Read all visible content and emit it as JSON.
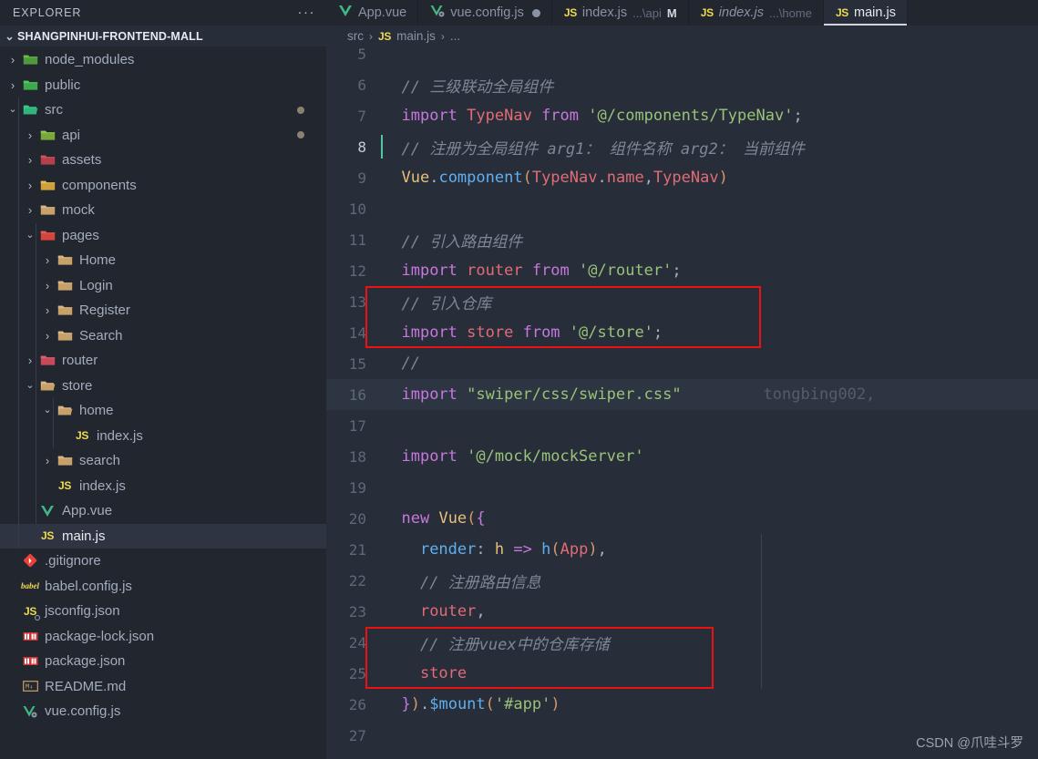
{
  "sidebar": {
    "header_title": "EXPLORER",
    "more_actions": "···",
    "root_label": "SHANGPINHUI-FRONTEND-MALL",
    "items": [
      {
        "label": "node_modules",
        "icon": "nodejs-folder-icon",
        "depth": 0,
        "state": "collapsed",
        "kind": "folder",
        "dirty": false
      },
      {
        "label": "public",
        "icon": "public-folder-icon",
        "depth": 0,
        "state": "collapsed",
        "kind": "folder",
        "dirty": false
      },
      {
        "label": "src",
        "icon": "src-folder-icon",
        "depth": 0,
        "state": "expanded",
        "kind": "folder",
        "dirty": true
      },
      {
        "label": "api",
        "icon": "api-folder-icon",
        "depth": 1,
        "state": "collapsed",
        "kind": "folder",
        "dirty": true
      },
      {
        "label": "assets",
        "icon": "assets-folder-icon",
        "depth": 1,
        "state": "collapsed",
        "kind": "folder",
        "dirty": false
      },
      {
        "label": "components",
        "icon": "components-folder-icon",
        "depth": 1,
        "state": "collapsed",
        "kind": "folder",
        "dirty": false
      },
      {
        "label": "mock",
        "icon": "folder-icon",
        "depth": 1,
        "state": "collapsed",
        "kind": "folder",
        "dirty": false
      },
      {
        "label": "pages",
        "icon": "pages-folder-icon",
        "depth": 1,
        "state": "expanded",
        "kind": "folder",
        "dirty": false
      },
      {
        "label": "Home",
        "icon": "folder-icon",
        "depth": 2,
        "state": "collapsed",
        "kind": "folder",
        "dirty": false
      },
      {
        "label": "Login",
        "icon": "folder-icon",
        "depth": 2,
        "state": "collapsed",
        "kind": "folder",
        "dirty": false
      },
      {
        "label": "Register",
        "icon": "folder-icon",
        "depth": 2,
        "state": "collapsed",
        "kind": "folder",
        "dirty": false
      },
      {
        "label": "Search",
        "icon": "folder-icon",
        "depth": 2,
        "state": "collapsed",
        "kind": "folder",
        "dirty": false
      },
      {
        "label": "router",
        "icon": "router-folder-icon",
        "depth": 1,
        "state": "collapsed",
        "kind": "folder",
        "dirty": false
      },
      {
        "label": "store",
        "icon": "folder-open-icon",
        "depth": 1,
        "state": "expanded",
        "kind": "folder",
        "dirty": false
      },
      {
        "label": "home",
        "icon": "folder-open-icon",
        "depth": 2,
        "state": "expanded",
        "kind": "folder",
        "dirty": false
      },
      {
        "label": "index.js",
        "icon": "js-file-icon",
        "depth": 3,
        "state": "none",
        "kind": "file",
        "dirty": false
      },
      {
        "label": "search",
        "icon": "folder-icon",
        "depth": 2,
        "state": "collapsed",
        "kind": "folder",
        "dirty": false
      },
      {
        "label": "index.js",
        "icon": "js-file-icon",
        "depth": 2,
        "state": "none",
        "kind": "file",
        "dirty": false
      },
      {
        "label": "App.vue",
        "icon": "vue-file-icon",
        "depth": 1,
        "state": "none",
        "kind": "file",
        "dirty": false
      },
      {
        "label": "main.js",
        "icon": "js-file-icon",
        "depth": 1,
        "state": "none",
        "kind": "file",
        "dirty": false,
        "selected": true
      },
      {
        "label": ".gitignore",
        "icon": "git-file-icon",
        "depth": 0,
        "state": "none",
        "kind": "file",
        "dirty": false
      },
      {
        "label": "babel.config.js",
        "icon": "babel-file-icon",
        "depth": 0,
        "state": "none",
        "kind": "file",
        "dirty": false
      },
      {
        "label": "jsconfig.json",
        "icon": "jsconfig-file-icon",
        "depth": 0,
        "state": "none",
        "kind": "file",
        "dirty": false
      },
      {
        "label": "package-lock.json",
        "icon": "npm-file-icon",
        "depth": 0,
        "state": "none",
        "kind": "file",
        "dirty": false
      },
      {
        "label": "package.json",
        "icon": "npm-file-icon",
        "depth": 0,
        "state": "none",
        "kind": "file",
        "dirty": false
      },
      {
        "label": "README.md",
        "icon": "markdown-file-icon",
        "depth": 0,
        "state": "none",
        "kind": "file",
        "dirty": false
      },
      {
        "label": "vue.config.js",
        "icon": "vue-config-file-icon",
        "depth": 0,
        "state": "none",
        "kind": "file",
        "dirty": false
      }
    ]
  },
  "tabs": [
    {
      "name": "App.vue",
      "path": "",
      "badge": "",
      "icon": "vue-file-icon",
      "active": false,
      "preview": false,
      "dirty": false
    },
    {
      "name": "vue.config.js",
      "path": "",
      "badge": "",
      "icon": "vue-config-file-icon",
      "active": false,
      "preview": false,
      "dirty": true
    },
    {
      "name": "index.js",
      "path": "...\\api",
      "badge": "M",
      "icon": "js-file-icon",
      "active": false,
      "preview": false,
      "dirty": false
    },
    {
      "name": "index.js",
      "path": "...\\home",
      "badge": "",
      "icon": "js-file-icon",
      "active": false,
      "preview": true,
      "dirty": false
    },
    {
      "name": "main.js",
      "path": "",
      "badge": "",
      "icon": "js-file-icon",
      "active": true,
      "preview": false,
      "dirty": false
    }
  ],
  "breadcrumb": {
    "folder": "src",
    "file": "main.js",
    "ellipsis": "...",
    "separator": "›"
  },
  "editor": {
    "blame_annotation": "tongbing002,",
    "highlighted_line": 16,
    "cursor_line": 8,
    "lines": [
      {
        "n": 5,
        "tokens": []
      },
      {
        "n": 6,
        "tokens": [
          {
            "t": "  ",
            "c": "pun"
          },
          {
            "t": "// 三级联动全局组件",
            "c": "cmt"
          }
        ]
      },
      {
        "n": 7,
        "tokens": [
          {
            "t": "  ",
            "c": "pun"
          },
          {
            "t": "import",
            "c": "kw"
          },
          {
            "t": " ",
            "c": "pun"
          },
          {
            "t": "TypeNav",
            "c": "var"
          },
          {
            "t": " ",
            "c": "pun"
          },
          {
            "t": "from",
            "c": "kw"
          },
          {
            "t": " ",
            "c": "pun"
          },
          {
            "t": "'@/components/TypeNav'",
            "c": "str"
          },
          {
            "t": ";",
            "c": "pun"
          }
        ]
      },
      {
        "n": 8,
        "tokens": [
          {
            "t": "  ",
            "c": "pun"
          },
          {
            "t": "// 注册为全局组件 arg1： 组件名称 arg2： 当前组件",
            "c": "cmt"
          }
        ]
      },
      {
        "n": 9,
        "tokens": [
          {
            "t": "  ",
            "c": "pun"
          },
          {
            "t": "Vue",
            "c": "cls"
          },
          {
            "t": ".",
            "c": "pun"
          },
          {
            "t": "component",
            "c": "fn"
          },
          {
            "t": "(",
            "c": "par"
          },
          {
            "t": "TypeNav",
            "c": "var"
          },
          {
            "t": ".",
            "c": "pun"
          },
          {
            "t": "name",
            "c": "var"
          },
          {
            "t": ",",
            "c": "pun"
          },
          {
            "t": "TypeNav",
            "c": "var"
          },
          {
            "t": ")",
            "c": "par"
          }
        ]
      },
      {
        "n": 10,
        "tokens": []
      },
      {
        "n": 11,
        "tokens": [
          {
            "t": "  ",
            "c": "pun"
          },
          {
            "t": "// 引入路由组件",
            "c": "cmt"
          }
        ]
      },
      {
        "n": 12,
        "tokens": [
          {
            "t": "  ",
            "c": "pun"
          },
          {
            "t": "import",
            "c": "kw"
          },
          {
            "t": " ",
            "c": "pun"
          },
          {
            "t": "router",
            "c": "var"
          },
          {
            "t": " ",
            "c": "pun"
          },
          {
            "t": "from",
            "c": "kw"
          },
          {
            "t": " ",
            "c": "pun"
          },
          {
            "t": "'@/router'",
            "c": "str"
          },
          {
            "t": ";",
            "c": "pun"
          }
        ]
      },
      {
        "n": 13,
        "tokens": [
          {
            "t": "  ",
            "c": "pun"
          },
          {
            "t": "// 引入仓库",
            "c": "cmt"
          }
        ]
      },
      {
        "n": 14,
        "tokens": [
          {
            "t": "  ",
            "c": "pun"
          },
          {
            "t": "import",
            "c": "kw"
          },
          {
            "t": " ",
            "c": "pun"
          },
          {
            "t": "store",
            "c": "var"
          },
          {
            "t": " ",
            "c": "pun"
          },
          {
            "t": "from",
            "c": "kw"
          },
          {
            "t": " ",
            "c": "pun"
          },
          {
            "t": "'@/store'",
            "c": "str"
          },
          {
            "t": ";",
            "c": "pun"
          }
        ]
      },
      {
        "n": 15,
        "tokens": [
          {
            "t": "  ",
            "c": "pun"
          },
          {
            "t": "//",
            "c": "cmt"
          }
        ]
      },
      {
        "n": 16,
        "tokens": [
          {
            "t": "  ",
            "c": "pun"
          },
          {
            "t": "import",
            "c": "kw"
          },
          {
            "t": " ",
            "c": "pun"
          },
          {
            "t": "\"swiper/css/swiper.css\"",
            "c": "str"
          }
        ]
      },
      {
        "n": 17,
        "tokens": []
      },
      {
        "n": 18,
        "tokens": [
          {
            "t": "  ",
            "c": "pun"
          },
          {
            "t": "import",
            "c": "kw"
          },
          {
            "t": " ",
            "c": "pun"
          },
          {
            "t": "'@/mock/mockServer'",
            "c": "str"
          }
        ]
      },
      {
        "n": 19,
        "tokens": []
      },
      {
        "n": 20,
        "tokens": [
          {
            "t": "  ",
            "c": "pun"
          },
          {
            "t": "new",
            "c": "kw"
          },
          {
            "t": " ",
            "c": "pun"
          },
          {
            "t": "Vue",
            "c": "cls"
          },
          {
            "t": "(",
            "c": "par"
          },
          {
            "t": "{",
            "c": "par2"
          }
        ]
      },
      {
        "n": 21,
        "tokens": [
          {
            "t": "    ",
            "c": "pun"
          },
          {
            "t": "render",
            "c": "prop"
          },
          {
            "t": ": ",
            "c": "pun"
          },
          {
            "t": "h",
            "c": "cls"
          },
          {
            "t": " ",
            "c": "pun"
          },
          {
            "t": "=>",
            "c": "kw"
          },
          {
            "t": " ",
            "c": "pun"
          },
          {
            "t": "h",
            "c": "fn"
          },
          {
            "t": "(",
            "c": "par"
          },
          {
            "t": "App",
            "c": "var"
          },
          {
            "t": ")",
            "c": "par"
          },
          {
            "t": ",",
            "c": "pun"
          }
        ]
      },
      {
        "n": 22,
        "tokens": [
          {
            "t": "    ",
            "c": "pun"
          },
          {
            "t": "// 注册路由信息",
            "c": "cmt"
          }
        ]
      },
      {
        "n": 23,
        "tokens": [
          {
            "t": "    ",
            "c": "pun"
          },
          {
            "t": "router",
            "c": "var"
          },
          {
            "t": ",",
            "c": "pun"
          }
        ]
      },
      {
        "n": 24,
        "tokens": [
          {
            "t": "    ",
            "c": "pun"
          },
          {
            "t": "// 注册vuex中的仓库存储",
            "c": "cmt"
          }
        ]
      },
      {
        "n": 25,
        "tokens": [
          {
            "t": "    ",
            "c": "pun"
          },
          {
            "t": "store",
            "c": "var"
          }
        ]
      },
      {
        "n": 26,
        "tokens": [
          {
            "t": "  ",
            "c": "pun"
          },
          {
            "t": "}",
            "c": "par2"
          },
          {
            "t": ")",
            "c": "par"
          },
          {
            "t": ".",
            "c": "pun"
          },
          {
            "t": "$mount",
            "c": "fn"
          },
          {
            "t": "(",
            "c": "par"
          },
          {
            "t": "'#app'",
            "c": "str"
          },
          {
            "t": ")",
            "c": "par"
          }
        ]
      },
      {
        "n": 27,
        "tokens": []
      }
    ],
    "annotations": [
      {
        "name": "store-import-highlight",
        "lines": [
          13,
          14
        ]
      },
      {
        "name": "store-register-highlight",
        "lines": [
          24,
          25
        ]
      }
    ]
  },
  "watermark": "CSDN @爪哇斗罗",
  "colors": {
    "accent_red": "#ee1111",
    "sidebar_bg": "#21262f",
    "editor_bg": "#272d39",
    "selection_bg": "#2e3442"
  }
}
